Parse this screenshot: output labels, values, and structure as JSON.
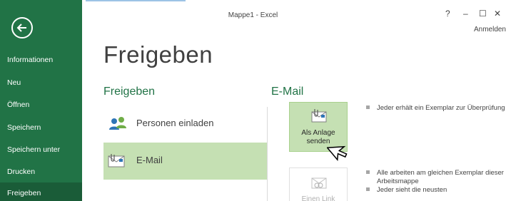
{
  "window": {
    "title": "Mappe1 - Excel",
    "help": "?",
    "minimize": "–",
    "maximize": "☐",
    "close": "✕",
    "signin": "Anmelden"
  },
  "sidebar": {
    "items": [
      {
        "label": "Informationen",
        "active": false
      },
      {
        "label": "Neu",
        "active": false
      },
      {
        "label": "Öffnen",
        "active": false
      },
      {
        "label": "Speichern",
        "active": false
      },
      {
        "label": "Speichern unter",
        "active": false
      },
      {
        "label": "Drucken",
        "active": false
      },
      {
        "label": "Freigeben",
        "active": true
      }
    ]
  },
  "page": {
    "title": "Freigeben"
  },
  "left": {
    "header": "Freigeben",
    "options": [
      {
        "label": "Personen einladen",
        "icon": "people-icon",
        "selected": false
      },
      {
        "label": "E-Mail",
        "icon": "email-icon",
        "selected": true
      }
    ]
  },
  "right": {
    "header": "E-Mail",
    "buttons": [
      {
        "label1": "Als Anlage",
        "label2": "senden",
        "icon": "attachment-mail-icon",
        "enabled": true
      },
      {
        "label1": "Einen Link",
        "label2": "",
        "icon": "link-mail-icon",
        "enabled": false
      }
    ],
    "desc1": [
      "Jeder erhält ein Exemplar zur Überprüfung"
    ],
    "desc2": [
      "Alle arbeiten am gleichen Exemplar dieser Arbeitsmappe",
      "Jeder sieht die neusten"
    ]
  },
  "colors": {
    "accent": "#217346",
    "selected": "#c5e0b3",
    "sidebar_active": "#1a5c38"
  }
}
